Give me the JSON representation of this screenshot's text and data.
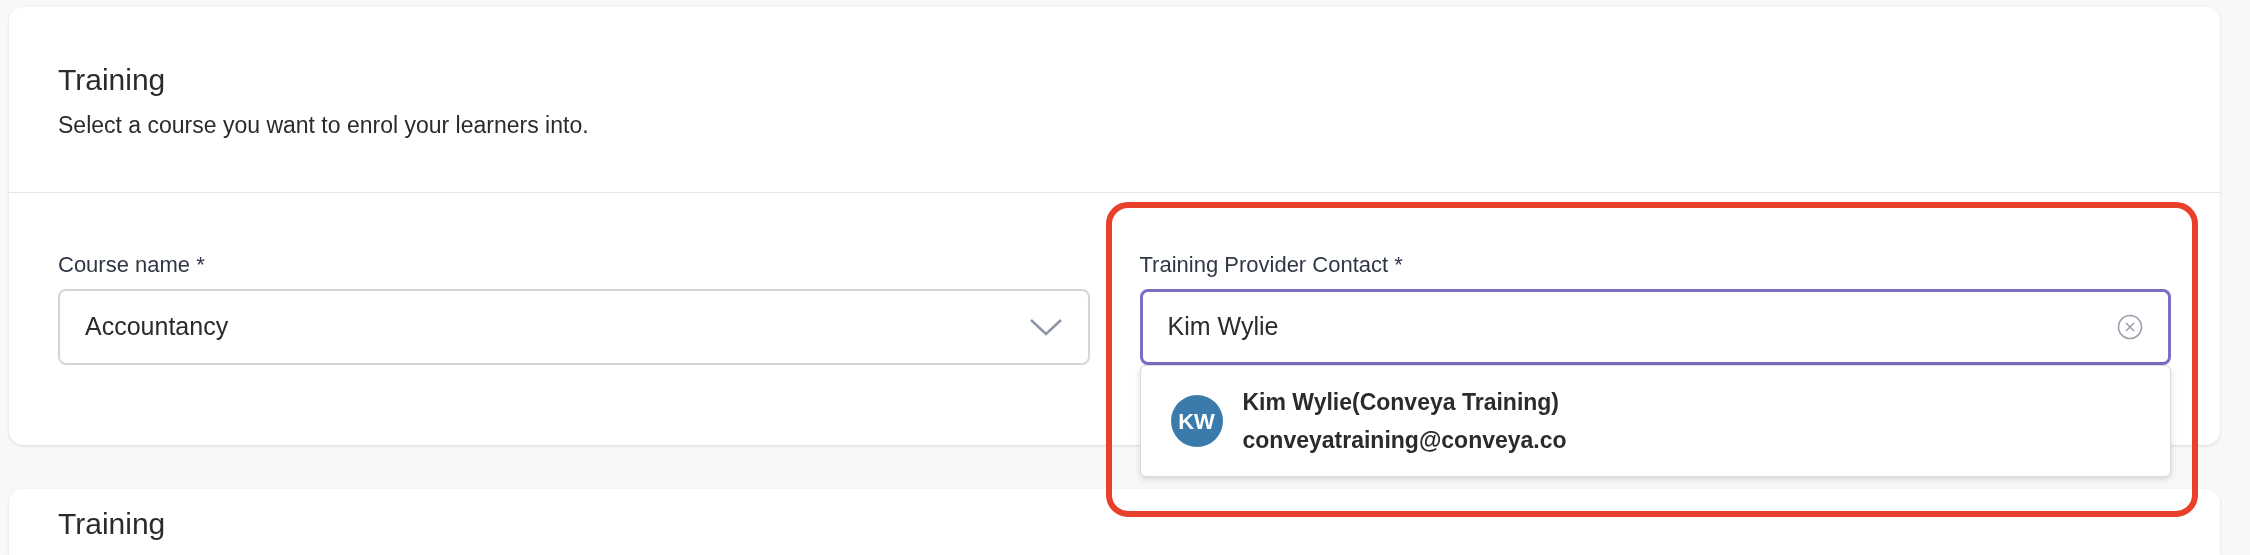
{
  "section": {
    "title": "Training",
    "description": "Select a course you want to enrol your learners into."
  },
  "fields": [
    {
      "kind": "select",
      "label": "Course name *",
      "value": "Accountancy",
      "focused": false
    },
    {
      "kind": "combobox",
      "label": "Training Provider Contact *",
      "value": "Kim Wylie",
      "focused": true,
      "highlighted": true,
      "options": [
        {
          "initials": "KW",
          "name": "Kim Wylie(Conveya Training)",
          "email": "conveyatraining@conveya.co",
          "color": "#3a7bab"
        }
      ]
    }
  ],
  "next_section": {
    "title": "Training"
  }
}
